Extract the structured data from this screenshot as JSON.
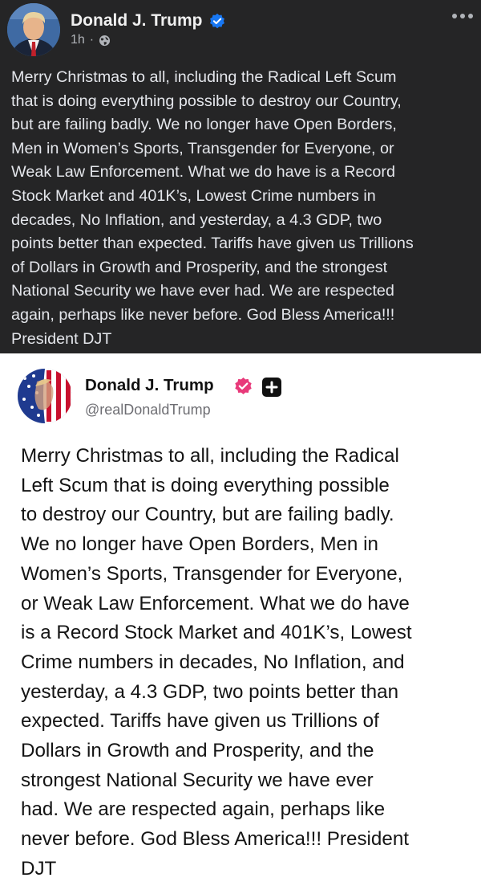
{
  "facebook_post": {
    "author_name": "Donald J. Trump",
    "timestamp": "1h",
    "separator": "·",
    "icons": {
      "verified": "verified-badge-icon",
      "audience": "globe-icon",
      "more": "more-options-icon"
    },
    "colors": {
      "background": "#252526",
      "verified": "#1877f2"
    },
    "body": "Merry Christmas to all, including the Radical Left Scum\nthat is doing everything possible to destroy our Country,\nbut are failing badly. We no longer have Open Borders,\nMen in Women’s Sports, Transgender for Everyone, or\nWeak Law Enforcement. What we do have is a Record\nStock Market and 401K’s, Lowest Crime numbers in\ndecades, No Inflation, and yesterday, a 4.3 GDP, two\npoints better than expected. Tariffs have given us Trillions\nof Dollars in Growth and Prosperity, and the strongest\nNational Security we have ever had. We are respected\nagain, perhaps like never before. God Bless America!!!\nPresident DJT"
  },
  "truth_social_post": {
    "author_name": "Donald J. Trump",
    "handle": "@realDonaldTrump",
    "icons": {
      "verified": "verified-badge-icon",
      "plus": "plus-badge-icon"
    },
    "colors": {
      "verified": "#e8397a",
      "background": "#ffffff"
    },
    "body": "Merry Christmas to all, including the Radical\nLeft Scum that is doing everything possible\nto destroy our Country, but are failing badly.\nWe no longer have Open Borders, Men in\nWomen’s Sports, Transgender for Everyone,\nor Weak Law Enforcement. What we do have\nis a Record Stock Market and 401K’s, Lowest\nCrime numbers in decades, No Inflation, and\nyesterday, a 4.3 GDP, two points better than\nexpected. Tariffs have given us Trillions of\nDollars in Growth and Prosperity, and the\nstrongest National Security we have ever\nhad. We are respected again, perhaps like\nnever before. God Bless America!!! President\nDJT"
  }
}
